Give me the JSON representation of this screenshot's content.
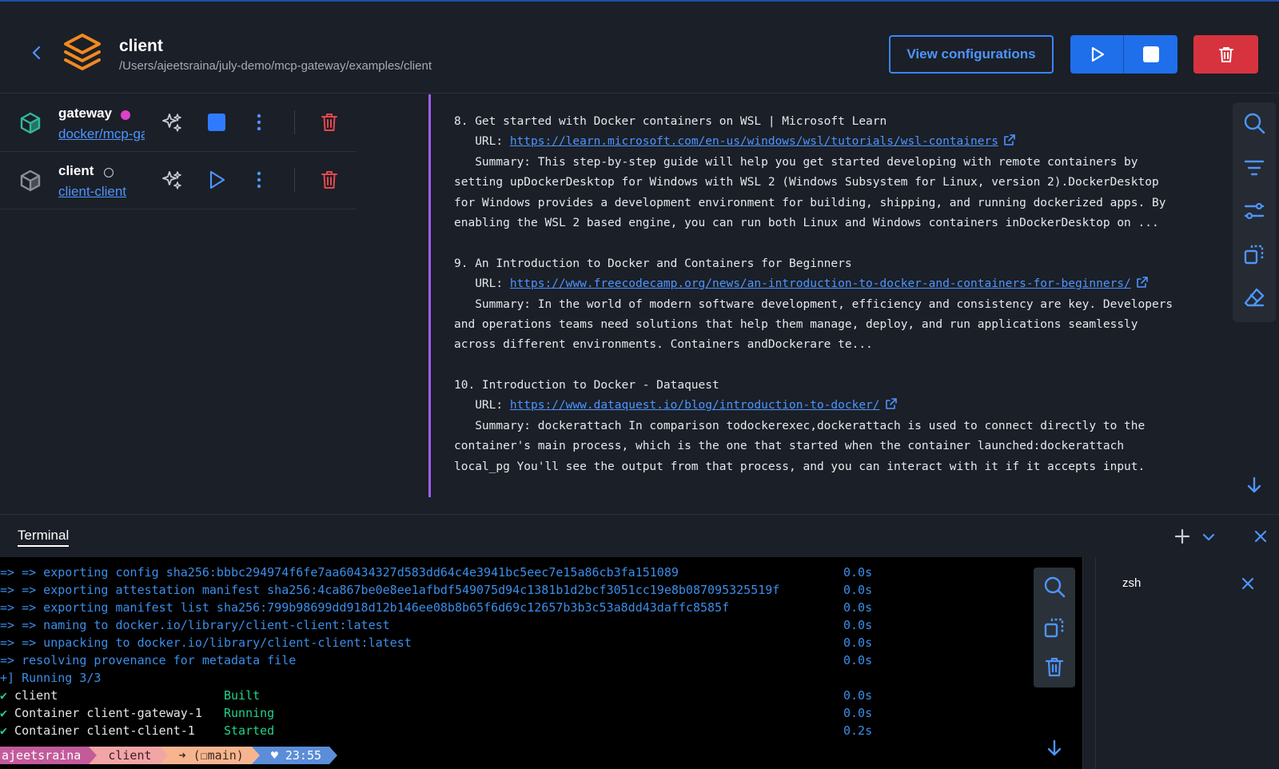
{
  "header": {
    "title": "client",
    "path": "/Users/ajeetsraina/july-demo/mcp-gateway/examples/client",
    "view_config_label": "View configurations"
  },
  "containers": [
    {
      "name": "gateway",
      "image": "docker/mcp-gateway",
      "status": "running",
      "status_color": "#e040c8"
    },
    {
      "name": "client",
      "image": "client-client",
      "status": "stopped",
      "status_color": "#c9ced6"
    }
  ],
  "logs": {
    "lines": [
      {
        "type": "text",
        "text": "8. Get started with Docker containers on WSL | Microsoft Learn"
      },
      {
        "type": "url",
        "prefix": "   URL: ",
        "url": "https://learn.microsoft.com/en-us/windows/wsl/tutorials/wsl-containers"
      },
      {
        "type": "text",
        "text": "   Summary: This step-by-step guide will help you get started developing with remote containers by"
      },
      {
        "type": "text",
        "text": "setting upDockerDesktop for Windows with WSL 2 (Windows Subsystem for Linux, version 2).DockerDesktop"
      },
      {
        "type": "text",
        "text": "for Windows provides a development environment for building, shipping, and running dockerized apps. By"
      },
      {
        "type": "text",
        "text": "enabling the WSL 2 based engine, you can run both Linux and Windows containers inDockerDesktop on ..."
      },
      {
        "type": "text",
        "text": ""
      },
      {
        "type": "text",
        "text": "9. An Introduction to Docker and Containers for Beginners"
      },
      {
        "type": "url",
        "prefix": "   URL: ",
        "url": "https://www.freecodecamp.org/news/an-introduction-to-docker-and-containers-for-beginners/"
      },
      {
        "type": "text",
        "text": "   Summary: In the world of modern software development, efficiency and consistency are key. Developers"
      },
      {
        "type": "text",
        "text": "and operations teams need solutions that help them manage, deploy, and run applications seamlessly"
      },
      {
        "type": "text",
        "text": "across different environments. Containers andDockerare te..."
      },
      {
        "type": "text",
        "text": ""
      },
      {
        "type": "text",
        "text": "10. Introduction to Docker - Dataquest"
      },
      {
        "type": "url",
        "prefix": "   URL: ",
        "url": "https://www.dataquest.io/blog/introduction-to-docker/"
      },
      {
        "type": "text",
        "text": "   Summary: dockerattach In comparison todockerexec,dockerattach is used to connect directly to the"
      },
      {
        "type": "text",
        "text": "container's main process, which is the one that started when the container launched:dockerattach"
      },
      {
        "type": "text",
        "text": "local_pg You'll see the output from that process, and you can interact with it if it accepts input."
      }
    ]
  },
  "terminal": {
    "tab_label": "Terminal",
    "session_name": "zsh",
    "lines": [
      {
        "text": "=> => exporting config sha256:bbbc294974f6fe7aa60434327d583dd64c4e3941bc5eec7e15a86cb3fa151089",
        "time": "0.0s",
        "color": "blue"
      },
      {
        "text": "=> => exporting attestation manifest sha256:4ca867be0e8ee1afbdf549075d94c1381b1d2bcf3051cc19e8b087095325519f",
        "time": "0.0s",
        "color": "blue"
      },
      {
        "text": "=> => exporting manifest list sha256:799b98699dd918d12b146ee08b8b65f6d69c12657b3b3c53a8dd43daffc8585f",
        "time": "0.0s",
        "color": "blue"
      },
      {
        "text": "=> => naming to docker.io/library/client-client:latest",
        "time": "0.0s",
        "color": "blue"
      },
      {
        "text": "=> => unpacking to docker.io/library/client-client:latest",
        "time": "0.0s",
        "color": "blue"
      },
      {
        "text": "=> resolving provenance for metadata file",
        "time": "0.0s",
        "color": "blue"
      },
      {
        "text": "+] Running 3/3",
        "time": "",
        "color": "blue"
      },
      {
        "text": "✔ client",
        "status": "Built",
        "time": "0.0s",
        "color": "white"
      },
      {
        "text": "✔ Container client-gateway-1",
        "status": "Running",
        "time": "0.0s",
        "color": "white"
      },
      {
        "text": "✔ Container client-client-1",
        "status": "Started",
        "time": "0.2s",
        "color": "white"
      }
    ],
    "prompt": {
      "user": "ajeetsraina",
      "dir": "client",
      "git": "➜ (☐main)",
      "time": "♥ 23:55"
    }
  },
  "icons": {
    "back": "chevron-left-icon",
    "app": "stack-layers-icon",
    "container": "cube-icon",
    "ai": "sparkles-icon",
    "search": "search-icon",
    "filter": "filter-icon",
    "settings": "sliders-icon",
    "copy": "copy-icon",
    "clear": "eraser-icon"
  },
  "colors": {
    "accent": "#1f6feb",
    "danger": "#d7333f",
    "log_border": "#a15cf4",
    "running_cube": "#2fb89a"
  }
}
